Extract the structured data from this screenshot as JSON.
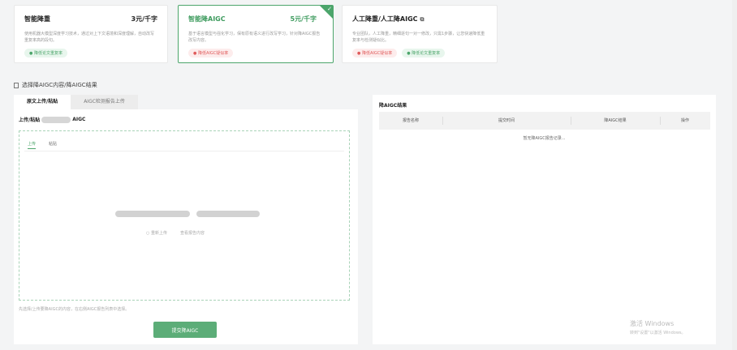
{
  "cards": [
    {
      "title": "智能降重",
      "price": "3元/千字",
      "desc": "使用机器大模型深度学习技术，通过对上下文语境和深度理解，自动改写重复率高的段句。",
      "tags": [
        {
          "text": "● 降低论文重复率",
          "color": "green"
        }
      ]
    },
    {
      "title": "智能降AIGC",
      "price": "5元/千字",
      "desc": "基于语言模型与强化学习，保有原有语义进行改写学习，针对降AIGC报告改写内容。",
      "tags": [
        {
          "text": "● 降低AIGC疑似率",
          "color": "red"
        }
      ],
      "selected": true
    },
    {
      "title": "人工降重/人工降AIGC",
      "price": "",
      "desc": "专业团队，人工降重，精细逐句一对一修改，只需1步骤，让您快速降低重复率与检测疑似比。",
      "tags": [
        {
          "text": "● 降低AIGC疑似率",
          "color": "red"
        },
        {
          "text": "● 降低论文重复率",
          "color": "green"
        }
      ]
    }
  ],
  "section_title": "选择降AIGC内容/降AIGC结果",
  "tabs": [
    "原文上传/粘贴",
    "AIGC检测报告上传"
  ],
  "upload": {
    "title_prefix": "上传/粘贴",
    "title_suffix": "AIGC",
    "inner_tabs": [
      "上传",
      "粘贴"
    ],
    "actions": [
      "○ 重新上传",
      "查看报告内容"
    ],
    "hint": "先选择/上传要降AIGC的内容，在右侧AIGC报告列表中选择。",
    "submit": "提交降AIGC"
  },
  "results": {
    "title": "降AIGC结果",
    "columns": [
      "报告名称",
      "提交时间",
      "降AIGC结果",
      "操作"
    ],
    "empty": "暂无降AIGC报告记录..."
  },
  "watermark": {
    "line1": "激活 Windows",
    "line2": "转到\"设置\"以激活 Windows。"
  }
}
